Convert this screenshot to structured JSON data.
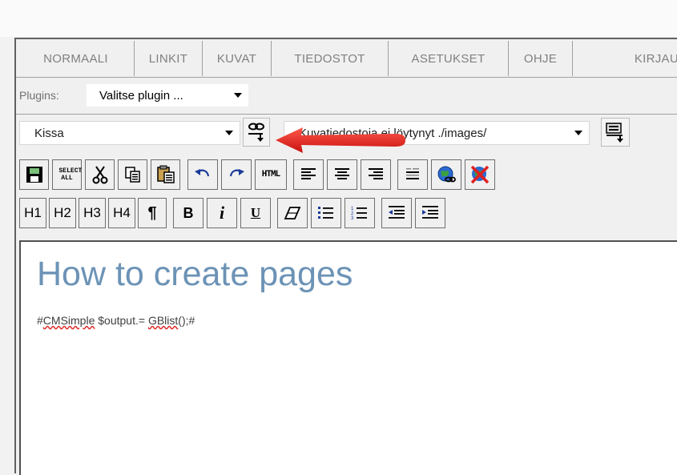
{
  "menu": {
    "items": [
      "NORMAALI",
      "LINKIT",
      "KUVAT",
      "TIEDOSTOT",
      "ASETUKSET",
      "OHJE",
      "KIRJAU"
    ]
  },
  "plugins": {
    "label": "Plugins:",
    "selected": "Valitse plugin ..."
  },
  "link_select": {
    "value": "Kissa"
  },
  "image_select": {
    "value": "Kuvatiedostoja ei löytynyt ./images/"
  },
  "toolbar1": {
    "select_all_label": "SELECT ALL",
    "html_label": "HTML"
  },
  "toolbar2": {
    "h1": "H1",
    "h2": "H2",
    "h3": "H3",
    "h4": "H4",
    "para": "¶",
    "bold": "B",
    "italic": "i",
    "underline": "U"
  },
  "editor": {
    "heading": "How to create pages",
    "code_prefix": "#",
    "code_word1": "CMSimple",
    "code_mid": " $output.= ",
    "code_word2": "GBlist",
    "code_suffix": "();#"
  },
  "colors": {
    "heading": "#6c93b6",
    "arrow": "#e02020"
  }
}
